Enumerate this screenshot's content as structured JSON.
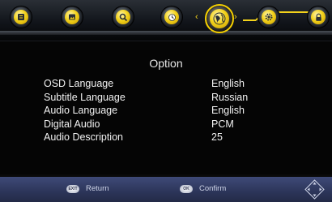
{
  "menu": {
    "icons": [
      "info-icon",
      "picture-icon",
      "search-icon",
      "clock-icon",
      "option-globe-icon",
      "settings-gear-icon",
      "lock-icon"
    ],
    "active_index": 4,
    "accent_color": "#f3d21b",
    "arrow_left": "‹",
    "arrow_right": "›"
  },
  "page": {
    "title": "Option",
    "rows": [
      {
        "label": "OSD Language",
        "value": "English"
      },
      {
        "label": "Subtitle Language",
        "value": "Russian"
      },
      {
        "label": "Audio Language",
        "value": "English"
      },
      {
        "label": "Digital Audio",
        "value": "PCM"
      },
      {
        "label": "Audio Description",
        "value": "25"
      }
    ]
  },
  "footer": {
    "return_key": "EXIT",
    "return_label": "Return",
    "confirm_key": "OK",
    "confirm_label": "Confirm"
  }
}
